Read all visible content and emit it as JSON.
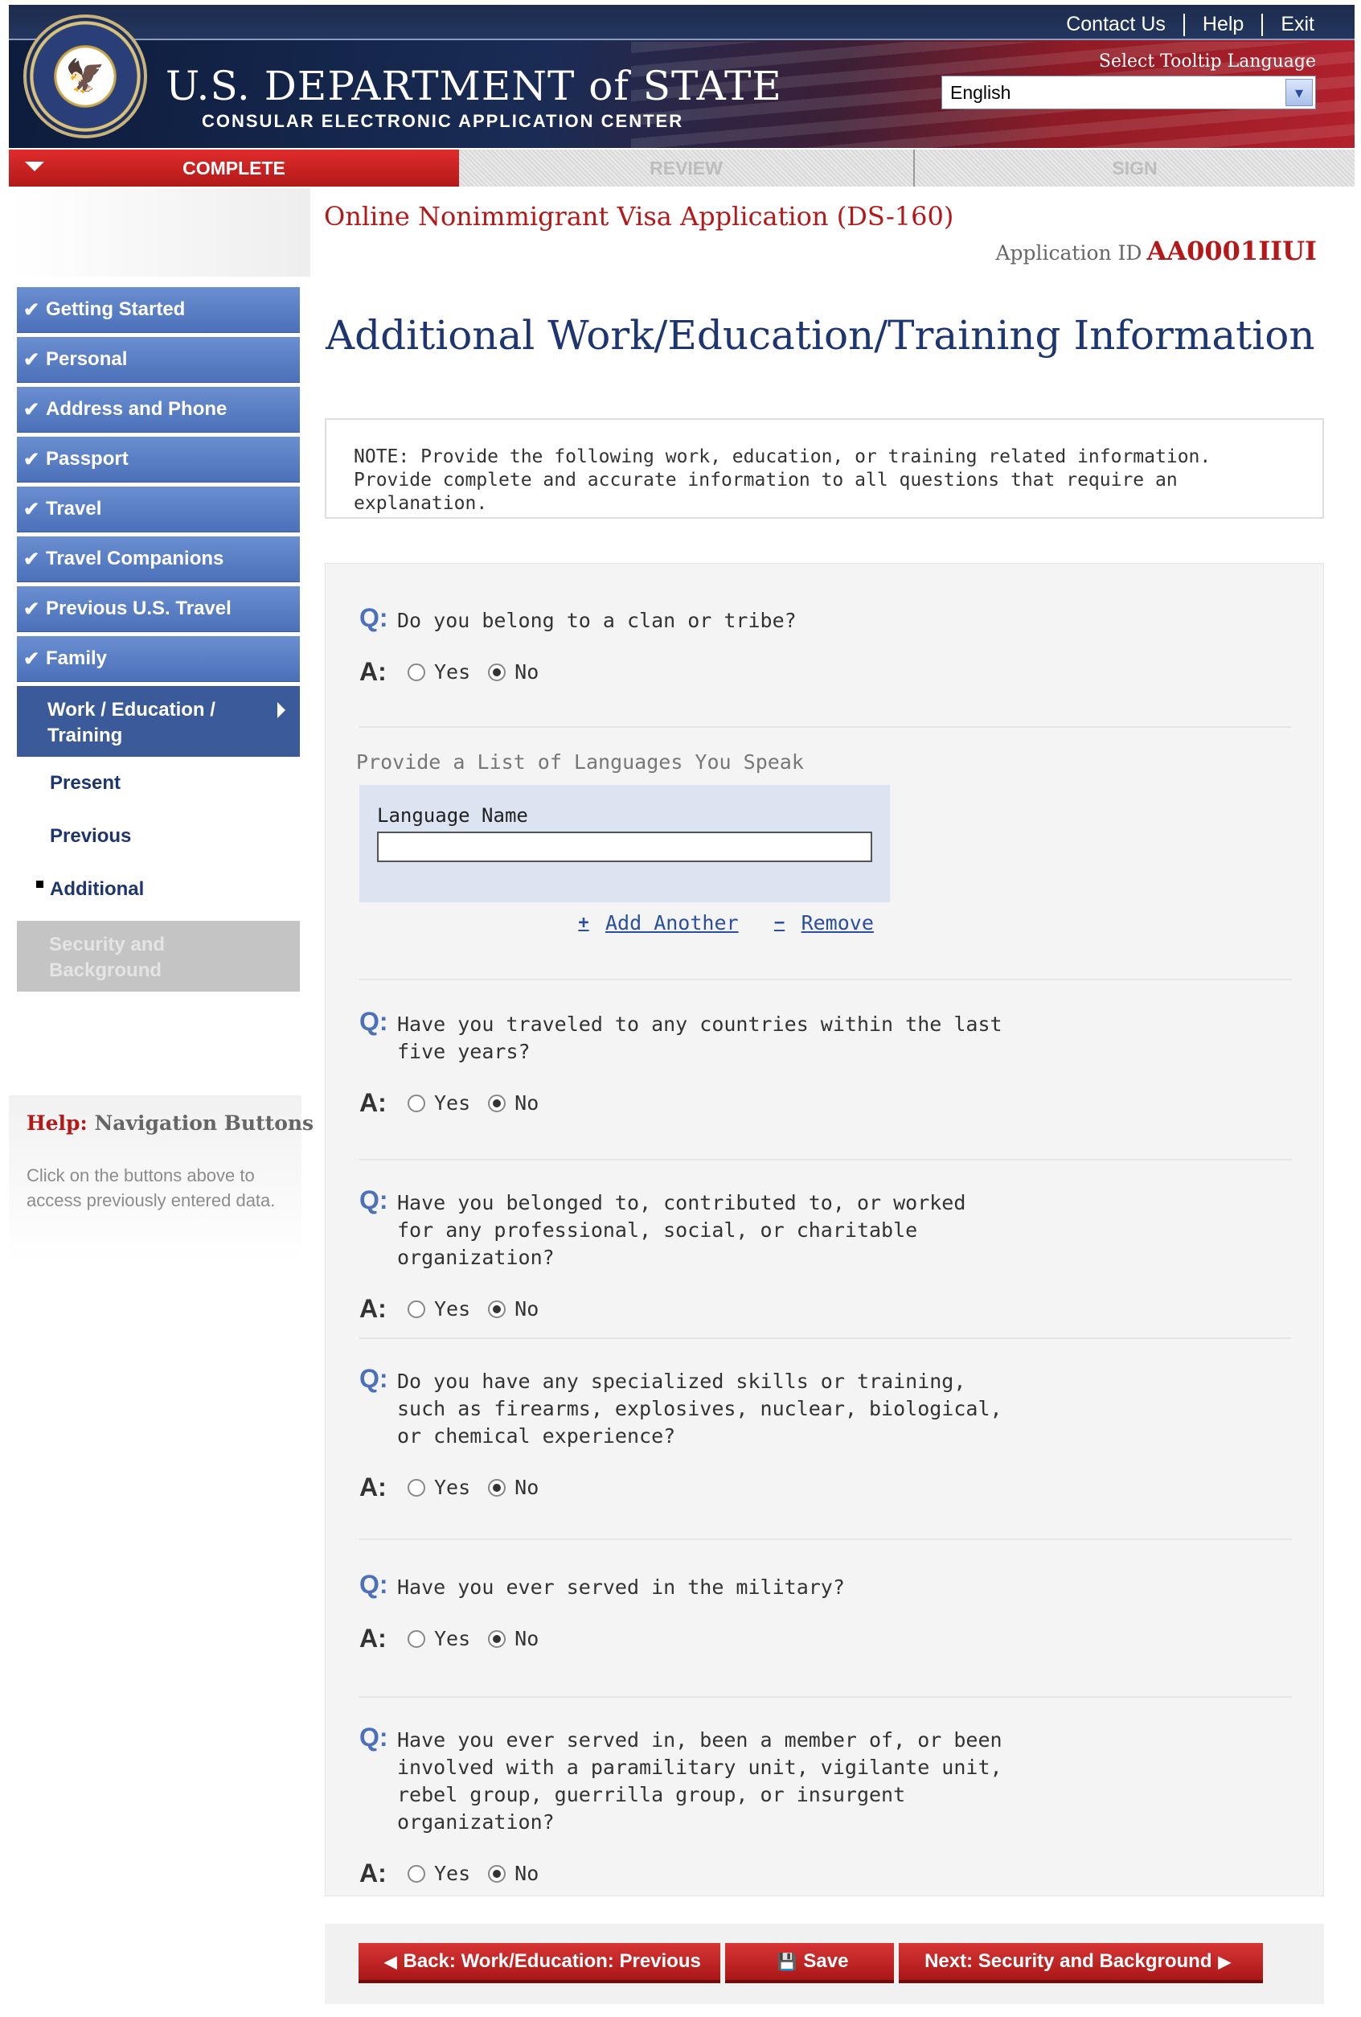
{
  "header": {
    "dept_title": "U.S. DEPARTMENT of STATE",
    "dept_sub": "CONSULAR ELECTRONIC APPLICATION CENTER",
    "links": {
      "contact": "Contact Us",
      "help": "Help",
      "exit": "Exit"
    },
    "tooltip_label": "Select Tooltip Language",
    "language": "English"
  },
  "steps": {
    "complete": "COMPLETE",
    "review": "REVIEW",
    "sign": "SIGN"
  },
  "sidebar": {
    "items": [
      {
        "label": "Getting Started"
      },
      {
        "label": "Personal"
      },
      {
        "label": "Address and Phone"
      },
      {
        "label": "Passport"
      },
      {
        "label": "Travel"
      },
      {
        "label": "Travel Companions"
      },
      {
        "label": "Previous U.S. Travel"
      },
      {
        "label": "Family"
      }
    ],
    "active": {
      "line1": "Work / Education /",
      "line2": "Training"
    },
    "subs": {
      "present": "Present",
      "previous": "Previous",
      "additional": "Additional"
    },
    "disabled": {
      "line1": "Security and",
      "line2": "Background"
    },
    "check": "✔"
  },
  "help": {
    "label": "Help:",
    "topic": "Navigation Buttons",
    "text": "Click on the buttons above to access previously entered data."
  },
  "main": {
    "app_title": "Online Nonimmigrant Visa Application (DS-160)",
    "app_id_label": "Application ID",
    "app_id": "AA0001IIUI",
    "page_title": "Additional Work/Education/Training Information",
    "note": "NOTE: Provide the following work, education, or training related information. Provide complete and accurate information to all questions that require an explanation."
  },
  "form": {
    "q_label": "Q:",
    "a_label": "A:",
    "yes": "Yes",
    "no": "No",
    "questions": [
      {
        "text": "Do you belong to a clan or tribe?",
        "answer": "No"
      },
      {
        "text": "Have you traveled to any countries within the last five years?",
        "answer": "No"
      },
      {
        "text": "Have you belonged to, contributed to, or worked for any professional, social, or charitable organization?",
        "answer": "No"
      },
      {
        "text": "Do you have any specialized skills or training, such as firearms, explosives, nuclear, biological, or chemical experience?",
        "answer": "No"
      },
      {
        "text": "Have you ever served in the military?",
        "answer": "No"
      },
      {
        "text": "Have you ever served in, been a member of, or been involved with a paramilitary unit, vigilante unit, rebel group, guerrilla group, or insurgent organization?",
        "answer": "No"
      }
    ],
    "languages_label": "Provide a List of Languages You Speak",
    "language_name_label": "Language Name",
    "language_name_value": "",
    "add_another": "Add Another",
    "remove": "Remove"
  },
  "buttons": {
    "back": "Back: Work/Education: Previous",
    "save": "Save",
    "next": "Next: Security and Background"
  }
}
